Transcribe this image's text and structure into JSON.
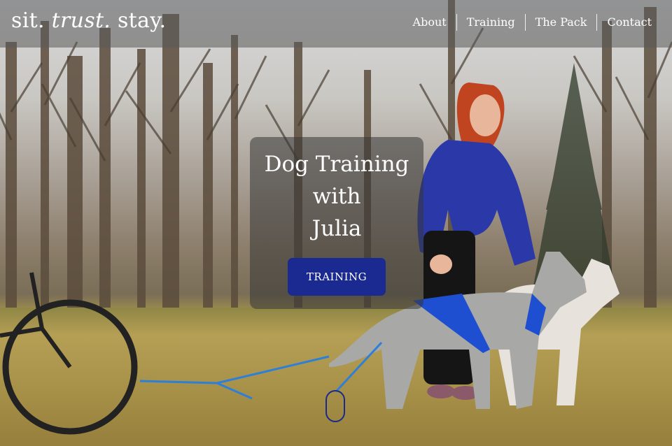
{
  "brand": {
    "prefix": "sit. ",
    "emphasis": "trust.",
    "suffix": " stay."
  },
  "nav": {
    "items": [
      {
        "label": "About"
      },
      {
        "label": "Training"
      },
      {
        "label": "The Pack"
      },
      {
        "label": "Contact"
      }
    ]
  },
  "hero": {
    "headline_line1": "Dog Training",
    "headline_line2": "with",
    "headline_line3": "Julia",
    "cta_label": "TRAINING"
  },
  "colors": {
    "cta_background": "#1a2a91",
    "topbar_overlay": "rgba(90,90,90,0.55)",
    "card_overlay": "rgba(55,55,55,0.55)",
    "scroll_indicator": "#1b2a8a"
  },
  "icons": {
    "scroll": "scroll-down-indicator-icon"
  }
}
